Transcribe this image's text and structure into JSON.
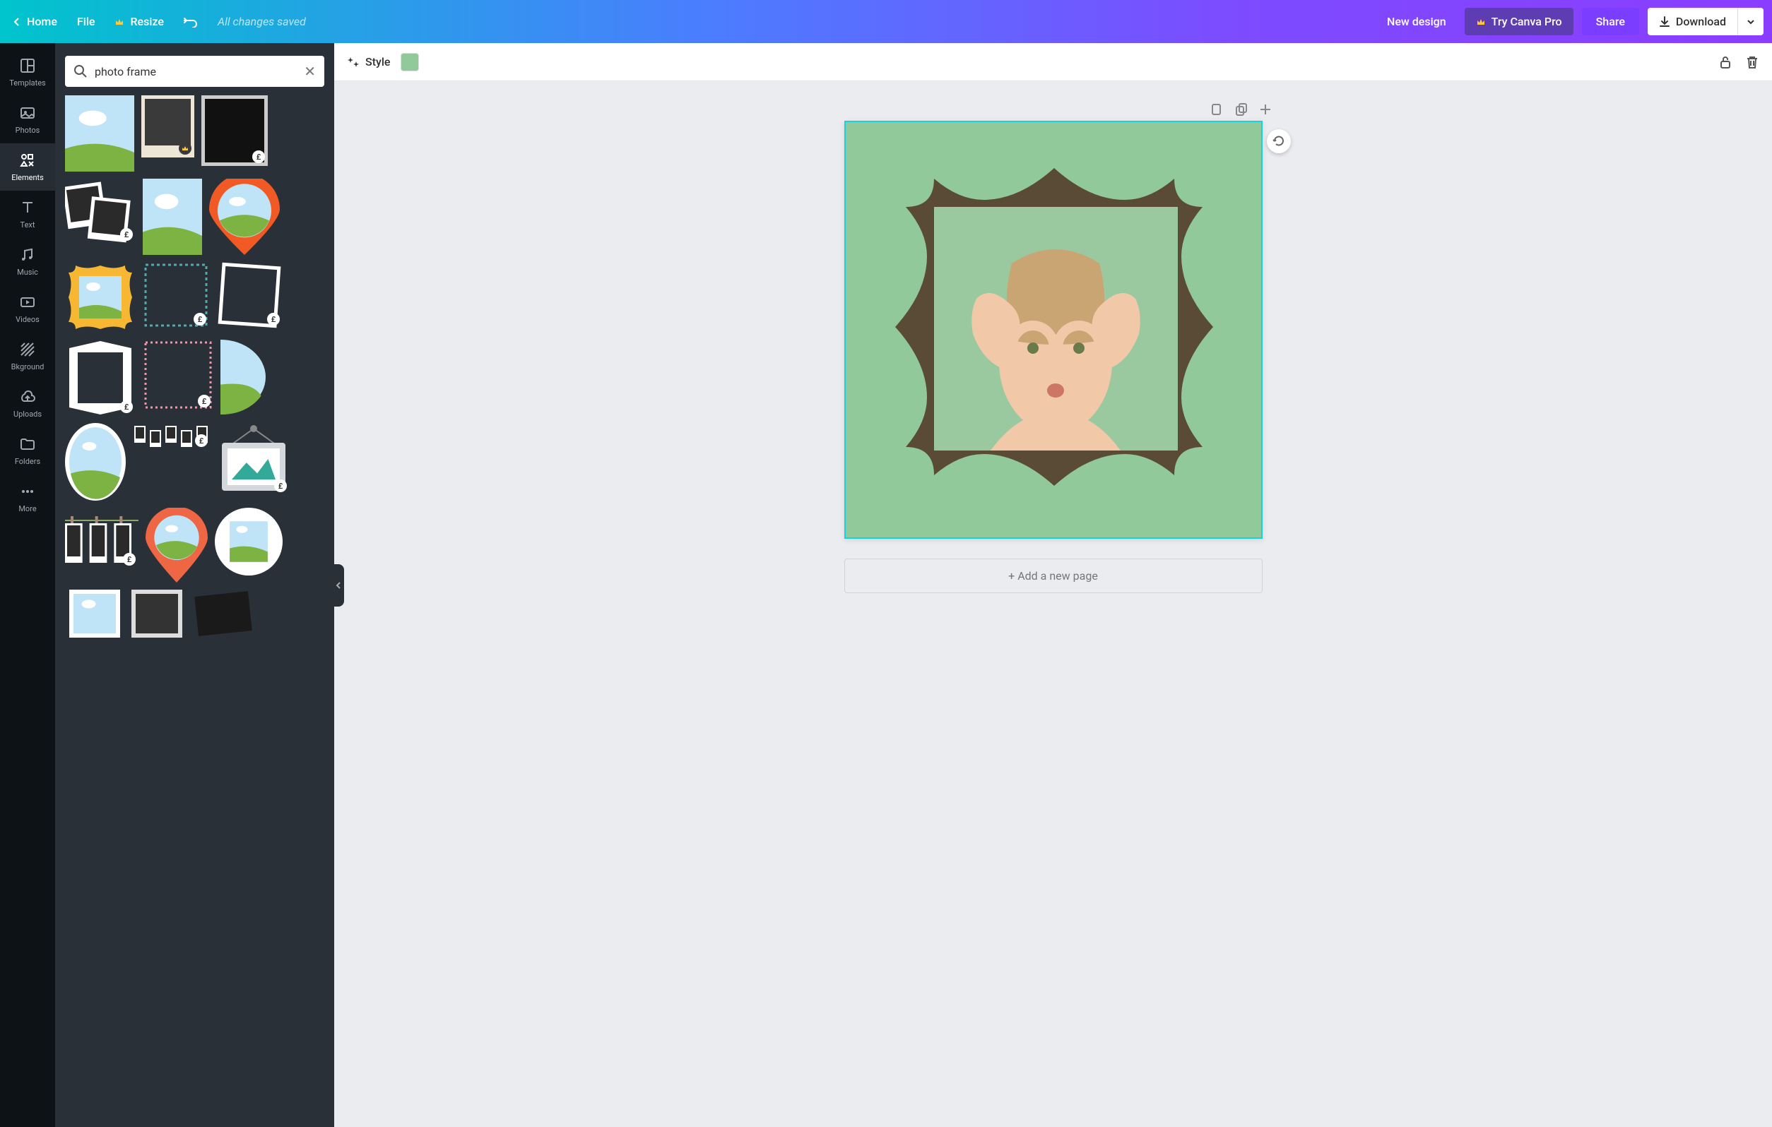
{
  "topbar": {
    "home": "Home",
    "file": "File",
    "resize": "Resize",
    "saved": "All changes saved",
    "new_design": "New design",
    "try_pro": "Try Canva Pro",
    "share": "Share",
    "download": "Download"
  },
  "rail": {
    "templates": "Templates",
    "photos": "Photos",
    "elements": "Elements",
    "text": "Text",
    "music": "Music",
    "videos": "Videos",
    "bkground": "Bkground",
    "uploads": "Uploads",
    "folders": "Folders",
    "more": "More"
  },
  "search": {
    "value": "photo frame"
  },
  "context": {
    "style": "Style",
    "swatch_color": "#92c99a"
  },
  "canvas": {
    "bg": "#92c99a",
    "frame_color": "#5a4b36",
    "add_page": "+ Add a new page"
  },
  "badges": {
    "pound": "£"
  },
  "tiles": [
    {
      "w": 98,
      "h": 108,
      "type": "landscape",
      "badge": null
    },
    {
      "w": 75,
      "h": 88,
      "type": "polaroid",
      "badge": "crown"
    },
    {
      "w": 94,
      "h": 100,
      "type": "rect-dark",
      "badge": "pound"
    },
    {
      "w": 100,
      "h": 92,
      "type": "double-photo",
      "badge": "pound"
    },
    {
      "w": 84,
      "h": 108,
      "type": "landscape",
      "badge": null
    },
    {
      "w": 100,
      "h": 108,
      "type": "pin-orange",
      "badge": null
    },
    {
      "w": 100,
      "h": 100,
      "type": "scallop-yellow",
      "badge": null
    },
    {
      "w": 94,
      "h": 94,
      "type": "stamp-teal",
      "badge": "pound"
    },
    {
      "w": 94,
      "h": 94,
      "type": "tilt-white",
      "badge": "pound"
    },
    {
      "w": 100,
      "h": 108,
      "type": "geo-white",
      "badge": "pound"
    },
    {
      "w": 100,
      "h": 100,
      "type": "stamp-pink",
      "badge": "pound"
    },
    {
      "w": 64,
      "h": 106,
      "type": "half-circle",
      "badge": null
    },
    {
      "w": 86,
      "h": 110,
      "type": "oval",
      "badge": null
    },
    {
      "w": 110,
      "h": 38,
      "type": "film-strip",
      "badge": "pound"
    },
    {
      "w": 102,
      "h": 102,
      "type": "hang-frame",
      "badge": "pound"
    },
    {
      "w": 104,
      "h": 86,
      "type": "cloth-line",
      "badge": "pound"
    },
    {
      "w": 88,
      "h": 106,
      "type": "pin-red",
      "badge": null
    },
    {
      "w": 96,
      "h": 96,
      "type": "circle-white",
      "badge": null
    },
    {
      "w": 84,
      "h": 68,
      "type": "landscape-tall",
      "badge": null
    },
    {
      "w": 72,
      "h": 68,
      "type": "dark-frame",
      "badge": null
    },
    {
      "w": 96,
      "h": 68,
      "type": "tilt-dark",
      "badge": null
    }
  ]
}
